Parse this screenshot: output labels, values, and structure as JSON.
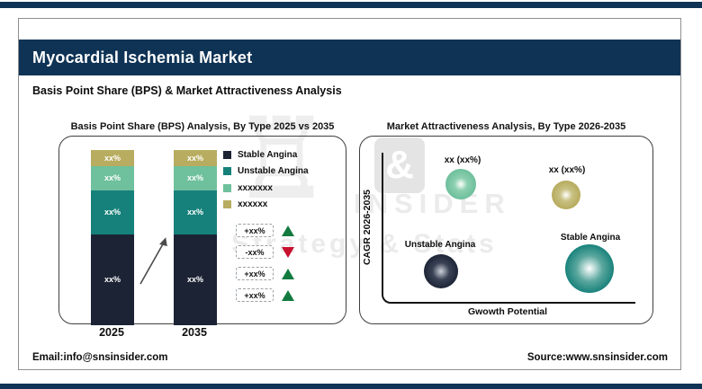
{
  "page": {
    "title": "Myocardial Ischemia Market",
    "subtitle": "Basis Point Share (BPS) & Market Attractiveness Analysis",
    "footer_email": "Email:info@snsinsider.com",
    "footer_source": "Source:www.snsinsider.com"
  },
  "colors": {
    "banner_navy": "#0f3355",
    "stable_angina_navy": "#1b2334",
    "unstable_angina_teal": "#16817a",
    "light_green": "#6fc09d",
    "olive": "#b7ac5f",
    "up_triangle_green": "#127a3f",
    "down_triangle_red": "#c8102e"
  },
  "watermark": {
    "rook": "♖",
    "ampersand": "&",
    "insider": "INSIDER",
    "strategy": "Strategy & Stats"
  },
  "bps_chart": {
    "title": "Basis Point Share (BPS) Analysis, By Type 2025 vs 2035",
    "bars": [
      {
        "year": "2025",
        "segments": [
          {
            "name": "xxxxxx",
            "label": "xx%"
          },
          {
            "name": "xxxxxxx",
            "label": "xx%"
          },
          {
            "name": "Unstable Angina",
            "label": "xx%"
          },
          {
            "name": "Stable Angina",
            "label": "xx%"
          }
        ]
      },
      {
        "year": "2035",
        "segments": [
          {
            "name": "xxxxxx",
            "label": "xx%"
          },
          {
            "name": "xxxxxxx",
            "label": "xx%"
          },
          {
            "name": "Unstable Angina",
            "label": "xx%"
          },
          {
            "name": "Stable Angina",
            "label": "xx%"
          }
        ]
      }
    ],
    "legend": [
      {
        "label": "Stable Angina",
        "color": "#1b2334"
      },
      {
        "label": "Unstable Angina",
        "color": "#16817a"
      },
      {
        "label": "xxxxxxx",
        "color": "#6fc09d"
      },
      {
        "label": "xxxxxx",
        "color": "#b7ac5f"
      }
    ],
    "changes": [
      {
        "value": "+xx%",
        "direction": "up"
      },
      {
        "value": "-xx%",
        "direction": "down"
      },
      {
        "value": "+xx%",
        "direction": "up"
      },
      {
        "value": "+xx%",
        "direction": "up"
      }
    ]
  },
  "attractiveness_chart": {
    "title": "Market Attractiveness Analysis, By Type 2026-2035",
    "y_axis_label": "CAGR 2026-2035",
    "x_axis_label": "Gwowth Potential",
    "bubbles": [
      {
        "label": "xx (xx%)",
        "color": "#6fc09d"
      },
      {
        "label": "xx (xx%)",
        "color": "#b7ac5f"
      },
      {
        "label": "Unstable Angina",
        "color": "#1b2334"
      },
      {
        "label": "Stable Angina",
        "color": "#16817a"
      }
    ]
  },
  "chart_data": [
    {
      "type": "bar",
      "stacked": true,
      "title": "Basis Point Share (BPS) Analysis, By Type 2025 vs 2035",
      "categories": [
        "2025",
        "2035"
      ],
      "series": [
        {
          "name": "Stable Angina",
          "values": [
            "xx%",
            "xx%"
          ],
          "approx_share_pct": [
            52,
            52
          ],
          "color": "#1b2334"
        },
        {
          "name": "Unstable Angina",
          "values": [
            "xx%",
            "xx%"
          ],
          "approx_share_pct": [
            25,
            25
          ],
          "color": "#16817a"
        },
        {
          "name": "xxxxxxx",
          "values": [
            "xx%",
            "xx%"
          ],
          "approx_share_pct": [
            14,
            14
          ],
          "color": "#6fc09d"
        },
        {
          "name": "xxxxxx",
          "values": [
            "xx%",
            "xx%"
          ],
          "approx_share_pct": [
            9,
            9
          ],
          "color": "#b7ac5f"
        }
      ],
      "annotations": [
        "+xx%",
        "-xx%",
        "+xx%",
        "+xx%"
      ],
      "legend_position": "right",
      "grid": false
    },
    {
      "type": "scatter",
      "title": "Market Attractiveness Analysis, By Type 2026-2035",
      "xlabel": "Gwowth Potential",
      "ylabel": "CAGR 2026-2035",
      "points": [
        {
          "label": "xx (xx%)",
          "x_relative": 0.31,
          "y_relative": 0.78,
          "size": "medium",
          "color": "#6fc09d"
        },
        {
          "label": "xx (xx%)",
          "x_relative": 0.73,
          "y_relative": 0.71,
          "size": "medium",
          "color": "#b7ac5f"
        },
        {
          "label": "Unstable Angina",
          "x_relative": 0.24,
          "y_relative": 0.2,
          "size": "medium",
          "color": "#1b2334"
        },
        {
          "label": "Stable Angina",
          "x_relative": 0.83,
          "y_relative": 0.22,
          "size": "large",
          "color": "#16817a"
        }
      ],
      "grid": false
    }
  ]
}
